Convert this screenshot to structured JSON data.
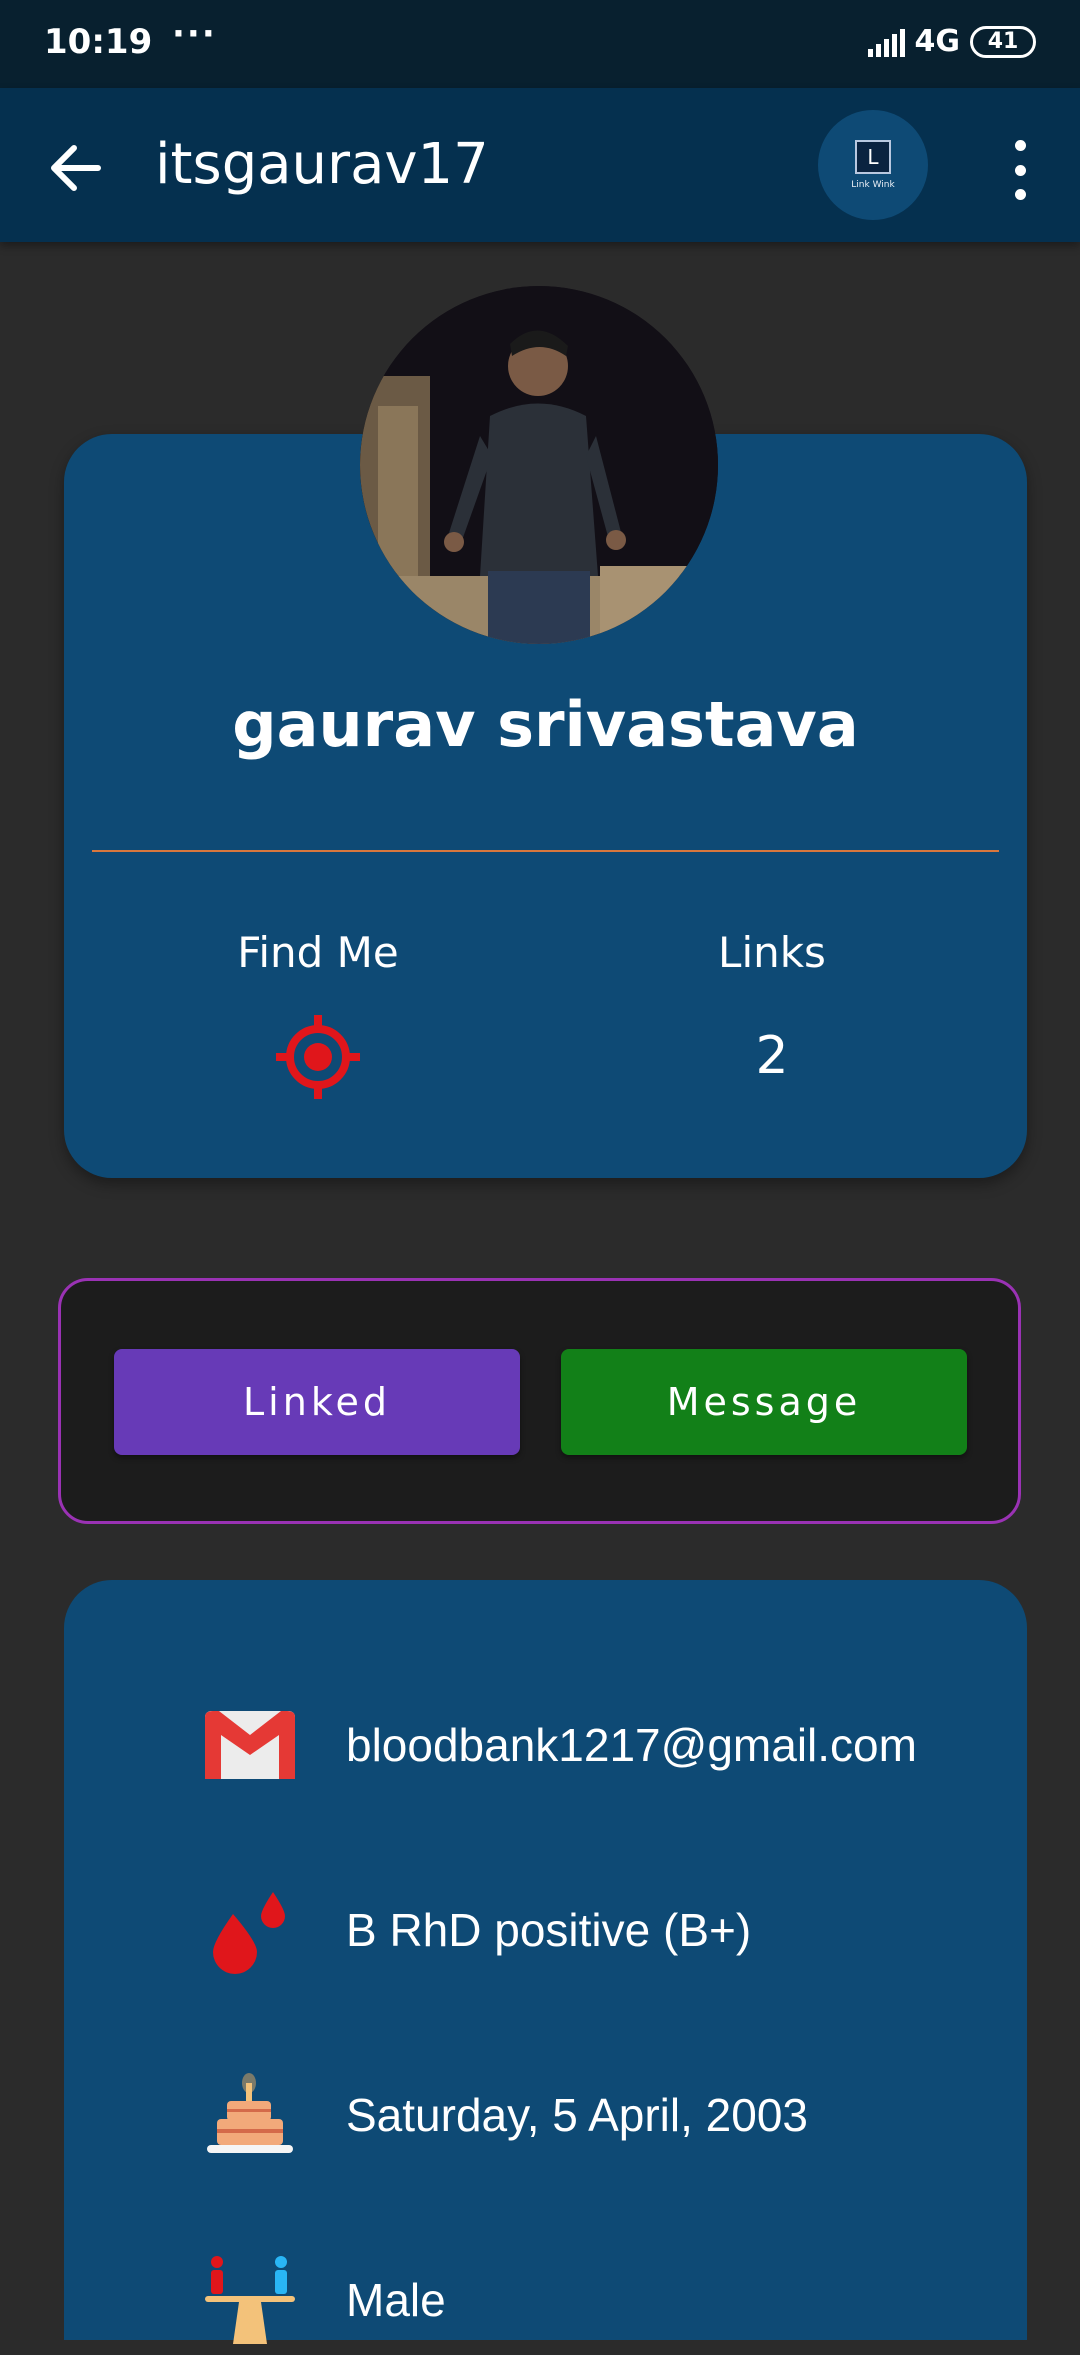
{
  "status_bar": {
    "time": "10:19",
    "dots": "···",
    "network": "4G",
    "battery": "41"
  },
  "app_bar": {
    "title": "itsgaurav17",
    "logo_letter": "L",
    "logo_text": "Link Wink"
  },
  "profile": {
    "name": "gaurav srivastava",
    "find_me_label": "Find Me",
    "links_label": "Links",
    "links_count": "2"
  },
  "actions": {
    "linked_label": "Linked",
    "message_label": "Message"
  },
  "info": {
    "email": "bloodbank1217@gmail.com",
    "blood_group": "B RhD positive (B+)",
    "birthday": "Saturday, 5 April, 2003",
    "gender": "Male"
  },
  "colors": {
    "app_bar": "#05304f",
    "card": "#0e4a75",
    "background": "#2b2b2b",
    "divider": "#d8773d",
    "linked_button": "#673ab7",
    "message_button": "#128018",
    "panel_border": "#9a32b4",
    "find_me_icon": "#e0161b"
  },
  "icons": {
    "back": "arrow-left-icon",
    "more": "more-vert-icon",
    "find_me": "gps-target-icon",
    "email": "gmail-icon",
    "blood": "blood-drop-icon",
    "birthday": "birthday-cake-icon",
    "gender": "gender-scale-icon"
  }
}
